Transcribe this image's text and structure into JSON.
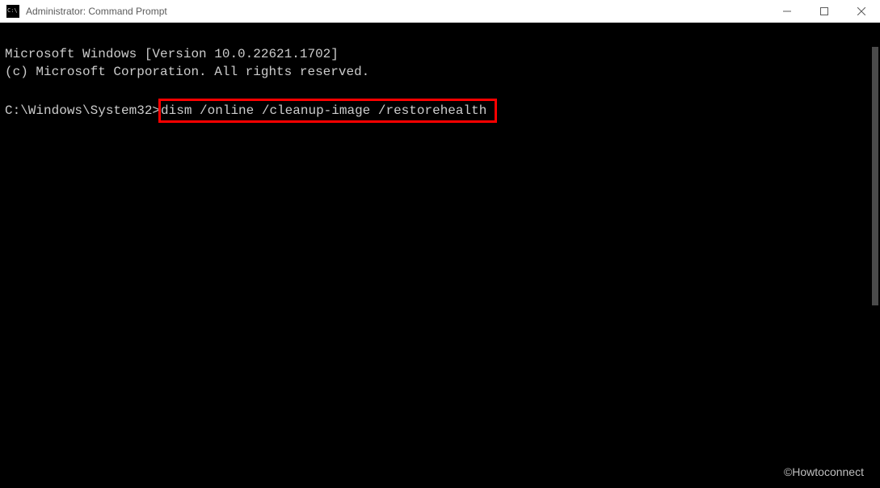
{
  "window": {
    "title": "Administrator: Command Prompt"
  },
  "terminal": {
    "line1": "Microsoft Windows [Version 10.0.22621.1702]",
    "line2": "(c) Microsoft Corporation. All rights reserved.",
    "prompt": "C:\\Windows\\System32>",
    "command": "dism /online /cleanup-image /restorehealth"
  },
  "watermark": "©Howtoconnect"
}
